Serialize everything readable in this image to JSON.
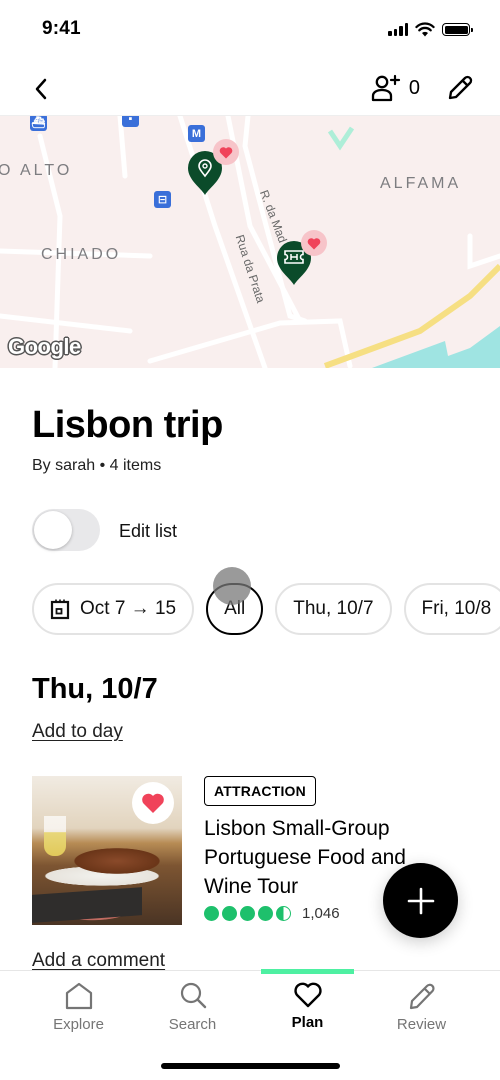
{
  "status_bar": {
    "time": "9:41"
  },
  "top_nav": {
    "back_icon": "chevron-left-icon",
    "collaborator_icon": "add-person-icon",
    "collaborator_count": "0",
    "edit_icon": "pencil-icon"
  },
  "map": {
    "neighborhoods": [
      "O ALTO",
      "CHIADO",
      "ALFAMA"
    ],
    "streets": [
      "Rua da Prata",
      "R. da Mad"
    ],
    "transit_icons": [
      "metro-icon",
      "tram-icon",
      "ferry-icon",
      "bus-icon"
    ],
    "metro_label": "M",
    "pins": [
      {
        "type": "location-pin-icon",
        "saved": true
      },
      {
        "type": "ticket-pin-icon",
        "saved": true
      }
    ],
    "attribution": "Google",
    "colors": {
      "pin": "#0b4b2a",
      "heart": "#f0435a",
      "heart_bg": "#f7c4c9",
      "water": "#9fe4e2",
      "highway": "#f6df83"
    }
  },
  "trip": {
    "title": "Lisbon trip",
    "meta": "By sarah • 4 items",
    "edit_toggle": {
      "label": "Edit list",
      "on": false
    }
  },
  "filters": {
    "chips": [
      {
        "label": "Oct 7 → 15",
        "icon": "calendar-icon",
        "active": false
      },
      {
        "label": "All",
        "active": true
      },
      {
        "label": "Thu, 10/7",
        "active": false
      },
      {
        "label": "Fri, 10/8",
        "active": false
      }
    ]
  },
  "day": {
    "heading": "Thu, 10/7",
    "add_link": "Add to day"
  },
  "items": [
    {
      "badge": "ATTRACTION",
      "title": "Lisbon Small-Group Portuguese Food and Wine Tour",
      "rating": 4.5,
      "rating_max": 5,
      "review_count": "1,046",
      "saved": true,
      "comment_link": "Add a comment"
    }
  ],
  "fab": {
    "icon": "plus-icon"
  },
  "tab_bar": {
    "active": "Plan",
    "accent": "#4ef0a2",
    "tabs": [
      {
        "label": "Explore",
        "icon": "home-icon"
      },
      {
        "label": "Search",
        "icon": "search-icon"
      },
      {
        "label": "Plan",
        "icon": "heart-icon"
      },
      {
        "label": "Review",
        "icon": "pencil-icon"
      }
    ]
  }
}
